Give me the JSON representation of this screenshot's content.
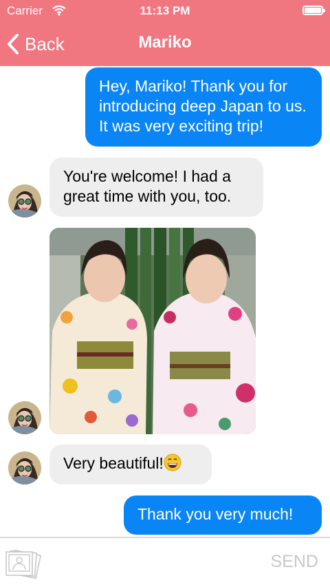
{
  "status_bar": {
    "carrier": "Carrier",
    "time": "11:13 PM",
    "wifi_icon": "wifi-icon",
    "battery_icon": "battery-icon"
  },
  "nav": {
    "back_label": "Back",
    "title": "Mariko",
    "back_icon": "chevron-left-icon",
    "color": "#f07680"
  },
  "messages": [
    {
      "direction": "outgoing",
      "text": "Hey, Mariko! Thank you for introducing deep Japan to us. It was very exciting trip!"
    },
    {
      "direction": "incoming",
      "text": "You're welcome! I had a great time with you, too."
    },
    {
      "direction": "incoming",
      "type": "image",
      "description_icon": "photo-image"
    },
    {
      "direction": "incoming",
      "text": "Very beautiful!",
      "emoji_icon": "smiling-face-emoji-icon"
    },
    {
      "direction": "outgoing",
      "text": "Thank you very much!"
    }
  ],
  "input_bar": {
    "photos_icon": "photo-library-icon",
    "send_label": "SEND"
  },
  "colors": {
    "outgoing_bubble": "#0a85f5",
    "incoming_bubble": "#eeeeee",
    "send_disabled": "#c8c8c8"
  }
}
